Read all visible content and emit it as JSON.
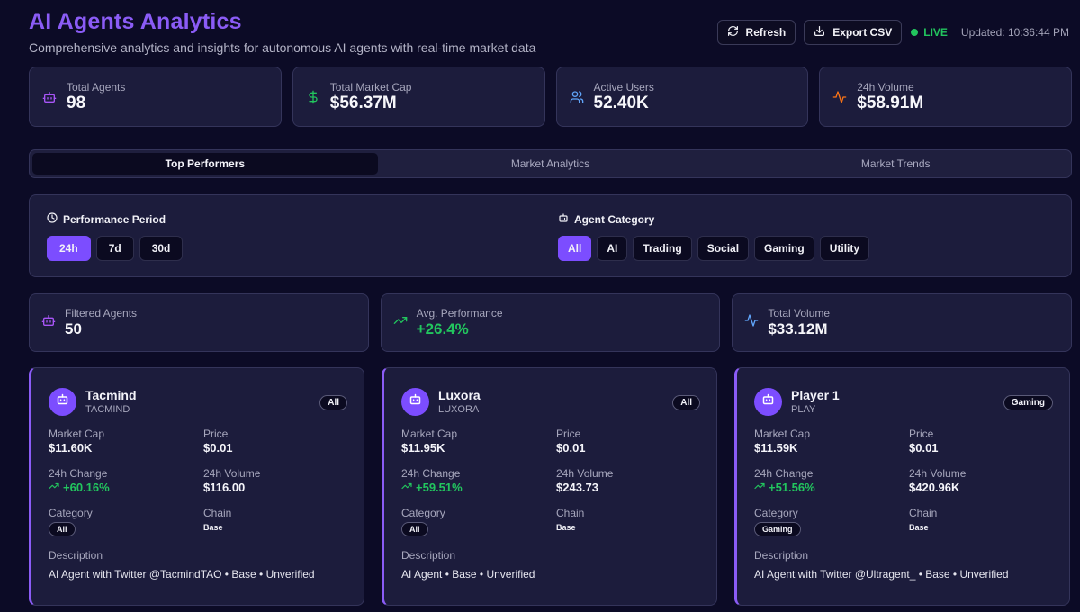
{
  "header": {
    "title": "AI Agents Analytics",
    "subtitle": "Comprehensive analytics and insights for autonomous AI agents with real-time market data",
    "refresh_label": "Refresh",
    "export_label": "Export CSV",
    "live_label": "LIVE",
    "updated": "Updated: 10:36:44 PM"
  },
  "stats": [
    {
      "label": "Total Agents",
      "value": "98",
      "icon": "robot-icon",
      "color": "#a855f7"
    },
    {
      "label": "Total Market Cap",
      "value": "$56.37M",
      "icon": "dollar-icon",
      "color": "#22c55e"
    },
    {
      "label": "Active Users",
      "value": "52.40K",
      "icon": "users-icon",
      "color": "#60a5fa"
    },
    {
      "label": "24h Volume",
      "value": "$58.91M",
      "icon": "activity-icon",
      "color": "#f97316"
    }
  ],
  "tabs": [
    {
      "label": "Top Performers",
      "active": true
    },
    {
      "label": "Market Analytics",
      "active": false
    },
    {
      "label": "Market Trends",
      "active": false
    }
  ],
  "filters": {
    "period_title": "Performance Period",
    "periods": [
      "24h",
      "7d",
      "30d"
    ],
    "active_period": "24h",
    "category_title": "Agent Category",
    "categories": [
      "All",
      "AI",
      "Trading",
      "Social",
      "Gaming",
      "Utility"
    ],
    "active_category": "All"
  },
  "summary": [
    {
      "label": "Filtered Agents",
      "value": "50",
      "icon": "robot-icon"
    },
    {
      "label": "Avg. Performance",
      "value": "+26.4%",
      "icon": "trending-up-icon"
    },
    {
      "label": "Total Volume",
      "value": "$33.12M",
      "icon": "activity-icon"
    }
  ],
  "agents": [
    {
      "name": "Tacmind",
      "symbol": "TACMIND",
      "badge": "All",
      "market_cap_label": "Market Cap",
      "market_cap": "$11.60K",
      "price_label": "Price",
      "price": "$0.01",
      "change_label": "24h Change",
      "change": "+60.16%",
      "volume_label": "24h Volume",
      "volume": "$116.00",
      "category_label": "Category",
      "category": "All",
      "chain_label": "Chain",
      "chain": "Base",
      "description_label": "Description",
      "description": "AI Agent with Twitter @TacmindTAO • Base • Unverified"
    },
    {
      "name": "Luxora",
      "symbol": "LUXORA",
      "badge": "All",
      "market_cap_label": "Market Cap",
      "market_cap": "$11.95K",
      "price_label": "Price",
      "price": "$0.01",
      "change_label": "24h Change",
      "change": "+59.51%",
      "volume_label": "24h Volume",
      "volume": "$243.73",
      "category_label": "Category",
      "category": "All",
      "chain_label": "Chain",
      "chain": "Base",
      "description_label": "Description",
      "description": "AI Agent • Base • Unverified"
    },
    {
      "name": "Player 1",
      "symbol": "PLAY",
      "badge": "Gaming",
      "market_cap_label": "Market Cap",
      "market_cap": "$11.59K",
      "price_label": "Price",
      "price": "$0.01",
      "change_label": "24h Change",
      "change": "+51.56%",
      "volume_label": "24h Volume",
      "volume": "$420.96K",
      "category_label": "Category",
      "category": "Gaming",
      "chain_label": "Chain",
      "chain": "Base",
      "description_label": "Description",
      "description": "AI Agent with Twitter @Ultragent_ • Base • Unverified"
    }
  ]
}
